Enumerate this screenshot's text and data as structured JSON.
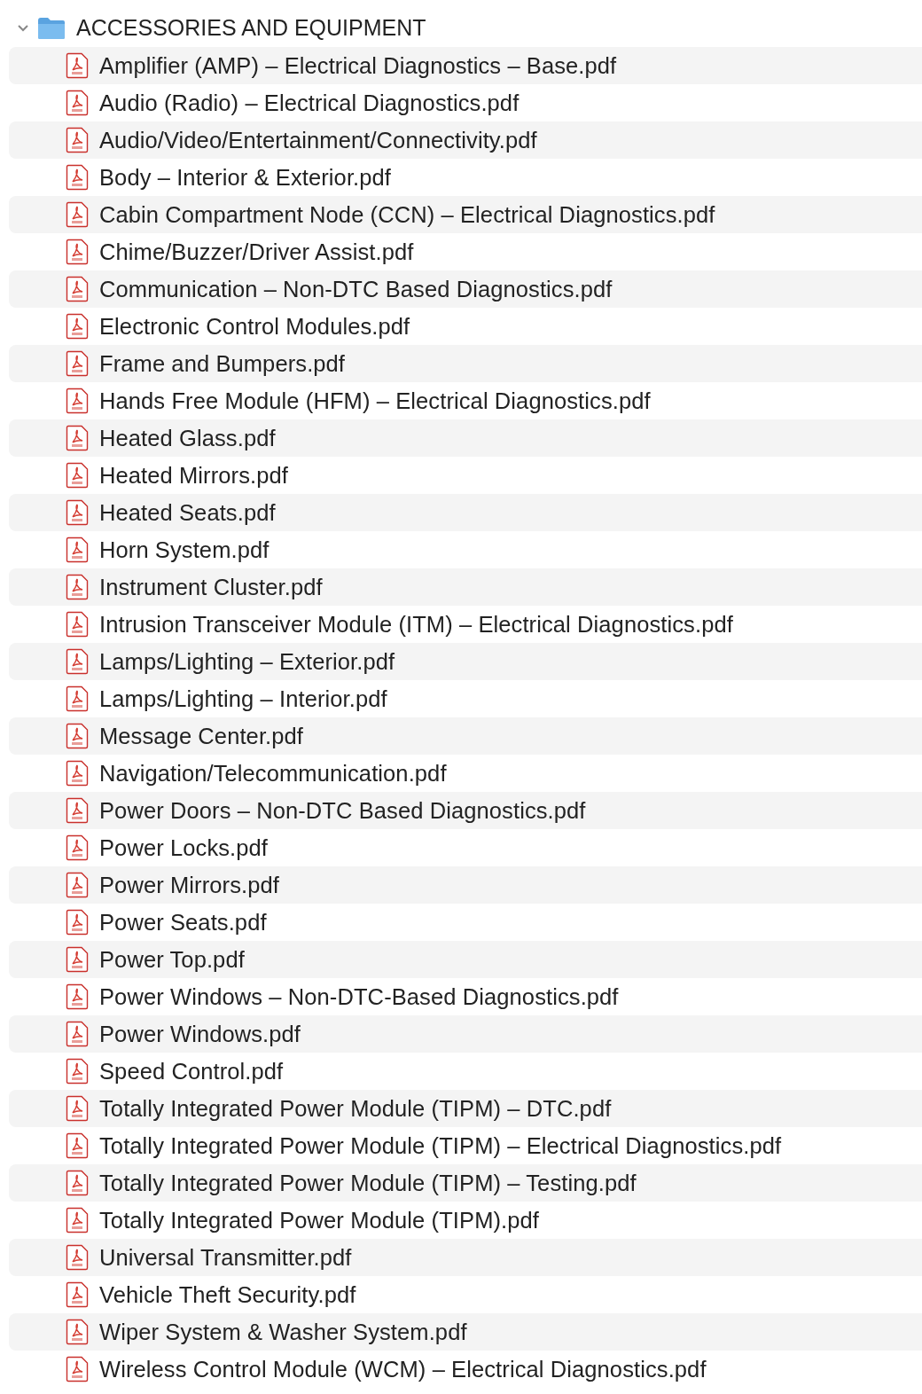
{
  "folder": {
    "name": "ACCESSORIES AND EQUIPMENT",
    "expanded": true,
    "files": [
      {
        "name": "Amplifier (AMP) – Electrical Diagnostics – Base.pdf"
      },
      {
        "name": "Audio (Radio) – Electrical Diagnostics.pdf"
      },
      {
        "name": "Audio/Video/Entertainment/Connectivity.pdf"
      },
      {
        "name": "Body – Interior & Exterior.pdf"
      },
      {
        "name": "Cabin Compartment Node (CCN) – Electrical Diagnostics.pdf"
      },
      {
        "name": "Chime/Buzzer/Driver Assist.pdf"
      },
      {
        "name": "Communication – Non-DTC Based Diagnostics.pdf"
      },
      {
        "name": "Electronic Control Modules.pdf"
      },
      {
        "name": "Frame and Bumpers.pdf"
      },
      {
        "name": "Hands Free Module (HFM) – Electrical Diagnostics.pdf"
      },
      {
        "name": "Heated Glass.pdf"
      },
      {
        "name": "Heated Mirrors.pdf"
      },
      {
        "name": "Heated Seats.pdf"
      },
      {
        "name": "Horn System.pdf"
      },
      {
        "name": "Instrument Cluster.pdf"
      },
      {
        "name": "Intrusion Transceiver Module (ITM) – Electrical Diagnostics.pdf"
      },
      {
        "name": "Lamps/Lighting – Exterior.pdf"
      },
      {
        "name": "Lamps/Lighting – Interior.pdf"
      },
      {
        "name": "Message Center.pdf"
      },
      {
        "name": "Navigation/Telecommunication.pdf"
      },
      {
        "name": "Power Doors – Non-DTC Based Diagnostics.pdf"
      },
      {
        "name": "Power Locks.pdf"
      },
      {
        "name": "Power Mirrors.pdf"
      },
      {
        "name": "Power Seats.pdf"
      },
      {
        "name": "Power Top.pdf"
      },
      {
        "name": "Power Windows – Non-DTC-Based Diagnostics.pdf"
      },
      {
        "name": "Power Windows.pdf"
      },
      {
        "name": "Speed Control.pdf"
      },
      {
        "name": "Totally Integrated Power Module (TIPM) – DTC.pdf"
      },
      {
        "name": "Totally Integrated Power Module (TIPM) – Electrical Diagnostics.pdf"
      },
      {
        "name": "Totally Integrated Power Module (TIPM) – Testing.pdf"
      },
      {
        "name": "Totally Integrated Power Module (TIPM).pdf"
      },
      {
        "name": "Universal Transmitter.pdf"
      },
      {
        "name": "Vehicle Theft Security.pdf"
      },
      {
        "name": "Wiper System & Washer System.pdf"
      },
      {
        "name": "Wireless Control Module (WCM) – Electrical Diagnostics.pdf"
      }
    ]
  }
}
